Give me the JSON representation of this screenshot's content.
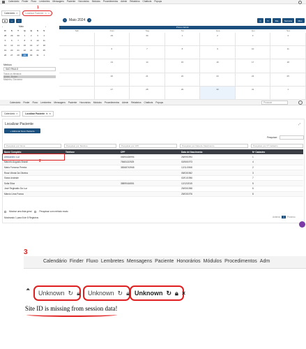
{
  "top_nav": {
    "items": [
      "Calendário",
      "Finder",
      "Fluxo",
      "Lembretes",
      "Mensagens",
      "Paciente",
      "Honorários",
      "Módulos",
      "Procedimentos",
      "Admin",
      "Relatórios",
      "Chatbots",
      "Popups"
    ]
  },
  "top_tabs": {
    "first": "Calendário",
    "second": "Localizar Paciente",
    "marker": "1"
  },
  "mini_calendar": {
    "month": "Maio",
    "weekdays": [
      "D",
      "S",
      "T",
      "Q",
      "Q",
      "S",
      "S"
    ],
    "weeks": [
      [
        "28",
        "29",
        "30",
        "1",
        "2",
        "3",
        "4"
      ],
      [
        "5",
        "6",
        "7",
        "8",
        "9",
        "10",
        "11"
      ],
      [
        "12",
        "13",
        "14",
        "15",
        "16",
        "17",
        "18"
      ],
      [
        "19",
        "20",
        "21",
        "22",
        "23",
        "24",
        "25"
      ],
      [
        "26",
        "27",
        "28",
        "29",
        "30",
        "31",
        "1"
      ]
    ],
    "selected": "29"
  },
  "doctor_filter": {
    "label": "Médicos",
    "select": "SAO PAULO",
    "items": [
      "Todos os Médicos",
      "Admin, Broker",
      "Madeira, Giovanna"
    ]
  },
  "calendar": {
    "title": "Maio 2024",
    "banner": "Primer Admin",
    "view_buttons": [
      "Dia",
      "Semana",
      "Mês"
    ],
    "weekdays": [
      "Sab",
      "Dom",
      "Seg",
      "Ter",
      "Qua",
      "Qui",
      "Sex"
    ],
    "rows": [
      [
        "29",
        "30",
        "1",
        "2",
        "3",
        "4"
      ],
      [
        "6",
        "7",
        "8",
        "9",
        "10",
        "11"
      ],
      [
        "13",
        "14",
        "15",
        "16",
        "17",
        "18"
      ],
      [
        "20",
        "21",
        "22",
        "23",
        "24",
        "25"
      ],
      [
        "27",
        "28",
        "29",
        "30",
        "31",
        "1"
      ]
    ]
  },
  "patient_page": {
    "nav_items": [
      "Calendário",
      "Finder",
      "Fluxo",
      "Lembretes",
      "Mensagens",
      "Paciente",
      "Honorários",
      "Módulos",
      "Procedimentos",
      "Admin",
      "Relatórios",
      "Chatbots",
      "Popups"
    ],
    "search_placeholder": "Procurar",
    "tab_first": "Calendário",
    "tab_active": "Localizar Paciente",
    "title": "Localizar Paciente",
    "add_button": "+ Adicionar Novo Paciente",
    "search_label": "Pesquisar:",
    "filters": [
      "Pesquisar por Nome",
      "Pesquisar por Telefone",
      "Pesquisar por CPF",
      "Pesquisar por Data de Nascimento",
      "Pesquisar por Nº Cadastro"
    ],
    "columns": [
      "Nome Completo",
      "Telefone",
      "CPF",
      "Data de Nascimento",
      "Nº Cadastro"
    ],
    "rows": [
      [
        "Alessandro Luz",
        "",
        "04694426994",
        "26/09/1994",
        "1"
      ],
      [
        "Marcelo Augusto Brandi",
        "",
        "78481132525",
        "02/06/1973",
        "4"
      ],
      [
        "Maria Fonseca Pereira",
        "",
        "38368743968",
        "12/11/1968",
        "2"
      ],
      [
        "Rosa Vitória Da Oliveira",
        "",
        "",
        "05/03/1962",
        "3"
      ],
      [
        "Siana Andrade",
        "",
        "",
        "02/01/1956",
        "7"
      ],
      [
        "Sofia Silva",
        "",
        "35899416551",
        "12/12/2015",
        "5"
      ],
      [
        "José Reginaldo Da Luz",
        "",
        "",
        "25/05/1958",
        "6"
      ],
      [
        "Márcio Lima Franco",
        "",
        "",
        "25/03/1976",
        "8"
      ]
    ],
    "row_marker": "2",
    "options": [
      "Mostrar uma lista geral",
      "Pesquisar com método exato"
    ],
    "footer": "Mostrando 1 para 8 de 8 Registros",
    "pagination": [
      "Anterior",
      "1",
      "Próximo"
    ]
  },
  "zoom": {
    "marker": "3",
    "nav_items": [
      "Calendário",
      "Finder",
      "Fluxo",
      "Lembretes",
      "Mensagens",
      "Paciente",
      "Honorários",
      "Módulos",
      "Procedimentos",
      "Adm"
    ],
    "tabs": [
      "Unknown",
      "Unknown",
      "Unknown"
    ],
    "error": "Site ID is missing from session data!"
  },
  "colors": {
    "primary": "#1b4f7d",
    "header_dark": "#3b3f45",
    "annotation": "#e02020"
  }
}
